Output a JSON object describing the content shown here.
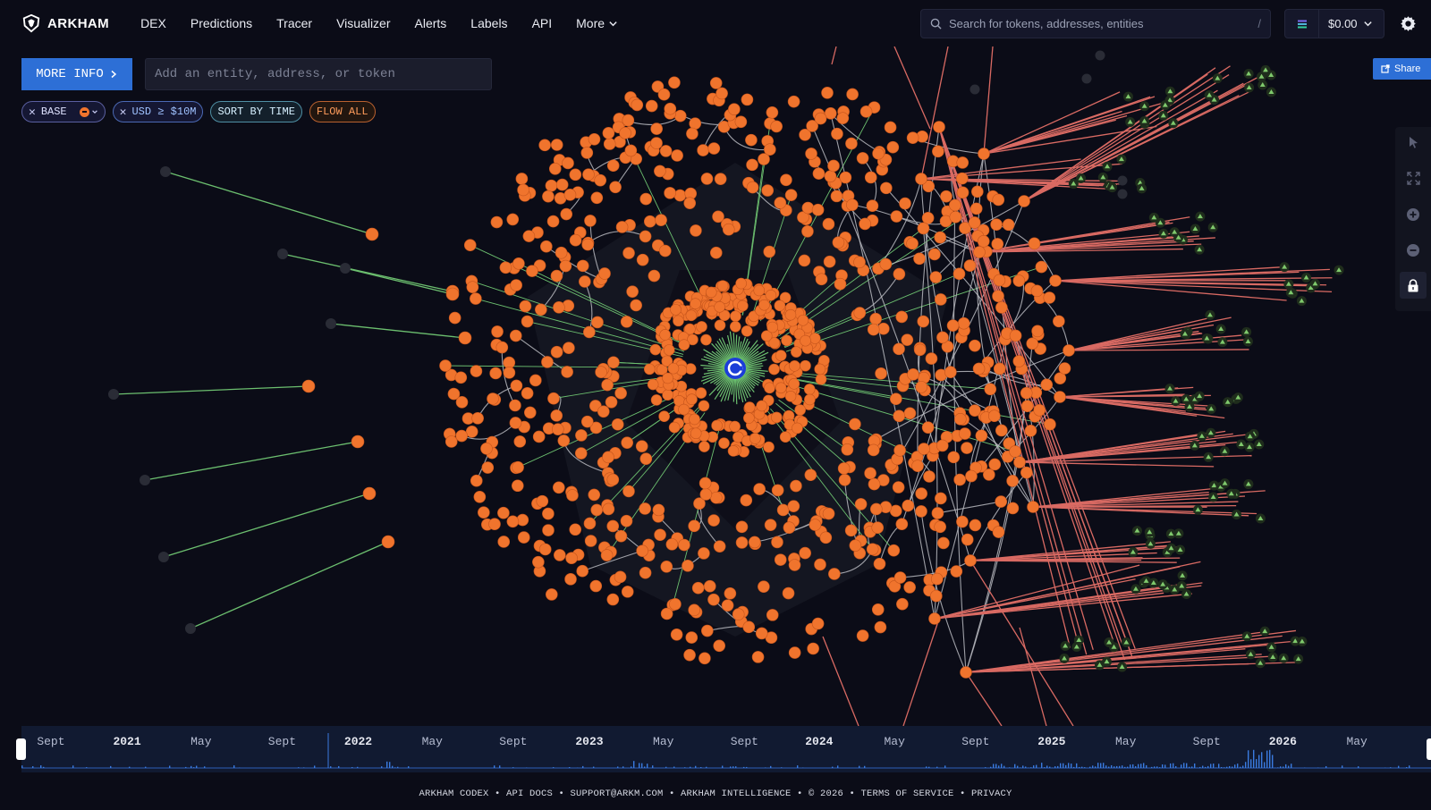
{
  "brand": {
    "name": "ARKHAM"
  },
  "nav": [
    {
      "label": "DEX",
      "key": "dex"
    },
    {
      "label": "Predictions",
      "key": "predictions"
    },
    {
      "label": "Tracer",
      "key": "tracer"
    },
    {
      "label": "Visualizer",
      "key": "visualizer"
    },
    {
      "label": "Alerts",
      "key": "alerts"
    },
    {
      "label": "Labels",
      "key": "labels"
    },
    {
      "label": "API",
      "key": "api"
    },
    {
      "label": "More",
      "key": "more"
    }
  ],
  "search": {
    "placeholder": "Search for tokens, addresses, entities",
    "shortcut": "/"
  },
  "wallet": {
    "balance": "$0.00"
  },
  "toolbar": {
    "more_info": "MORE INFO",
    "entity_placeholder": "Add an entity, address, or token",
    "share": "Share"
  },
  "filters": {
    "chain": "BASE",
    "usd": "USD ≥ $10M",
    "sort": "SORT BY TIME",
    "flow": "FLOW ALL"
  },
  "colors": {
    "background": "#0b0c17",
    "node_orange": "#f0742d",
    "node_dark": "#2a2c36",
    "node_green_dark": "#1f2d1c",
    "edge_gray": "#b9bac0",
    "edge_green": "#6cbf6f",
    "edge_red": "#d96a63",
    "accent_blue": "#2d6fd6"
  },
  "timeline": {
    "labels": [
      {
        "text": "Sept",
        "pos": 0.011,
        "year": false
      },
      {
        "text": "2021",
        "pos": 0.065,
        "year": true
      },
      {
        "text": "May",
        "pos": 0.12,
        "year": false
      },
      {
        "text": "Sept",
        "pos": 0.175,
        "year": false
      },
      {
        "text": "2022",
        "pos": 0.229,
        "year": true
      },
      {
        "text": "May",
        "pos": 0.284,
        "year": false
      },
      {
        "text": "Sept",
        "pos": 0.339,
        "year": false
      },
      {
        "text": "2023",
        "pos": 0.393,
        "year": true
      },
      {
        "text": "May",
        "pos": 0.448,
        "year": false
      },
      {
        "text": "Sept",
        "pos": 0.503,
        "year": false
      },
      {
        "text": "2024",
        "pos": 0.556,
        "year": true
      },
      {
        "text": "May",
        "pos": 0.612,
        "year": false
      },
      {
        "text": "Sept",
        "pos": 0.667,
        "year": false
      },
      {
        "text": "2025",
        "pos": 0.721,
        "year": true
      },
      {
        "text": "May",
        "pos": 0.776,
        "year": false
      },
      {
        "text": "Sept",
        "pos": 0.831,
        "year": false
      },
      {
        "text": "2026",
        "pos": 0.885,
        "year": true
      },
      {
        "text": "May",
        "pos": 0.94,
        "year": false
      }
    ]
  },
  "footer": "ARKHAM CODEX • API DOCS • SUPPORT@ARKM.COM • ARKHAM INTELLIGENCE • © 2026 • TERMS OF SERVICE • PRIVACY"
}
